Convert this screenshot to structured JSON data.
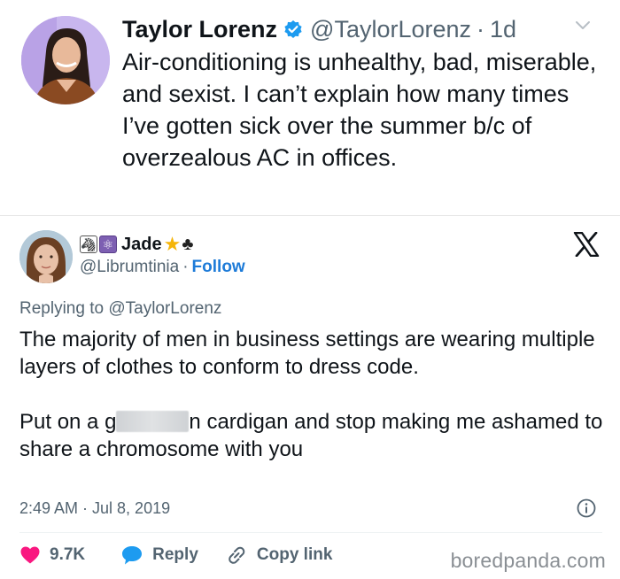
{
  "original_tweet": {
    "author_name": "Taylor Lorenz",
    "handle": "@TaylorLorenz",
    "separator": "·",
    "age": "1d",
    "text": "Air-conditioning is unhealthy, bad, miserable, and sexist. I can’t explain how many times I’ve gotten sick over the summer b/c of overzealous AC in offices.",
    "verified_color": "#1d9bf0"
  },
  "reply_tweet": {
    "display_name": "Jade",
    "handle": "@Librumtinia",
    "separator": "·",
    "follow_label": "Follow",
    "replying_to": "Replying to @TaylorLorenz",
    "paragraph_1": "The majority of men in business settings are wearing multiple layers of clothes to conform to dress code.",
    "paragraph_2_start": "Put on a g",
    "paragraph_2_end": "n cardigan and stop making me ashamed to share a chromosome with you",
    "timestamp": "2:49 AM · Jul 8, 2019",
    "like_count": "9.7K",
    "reply_label": "Reply",
    "copy_link_label": "Copy link",
    "accent_color": "#1d7bd8",
    "like_color": "#f91880"
  },
  "watermark": "boredpanda.com"
}
